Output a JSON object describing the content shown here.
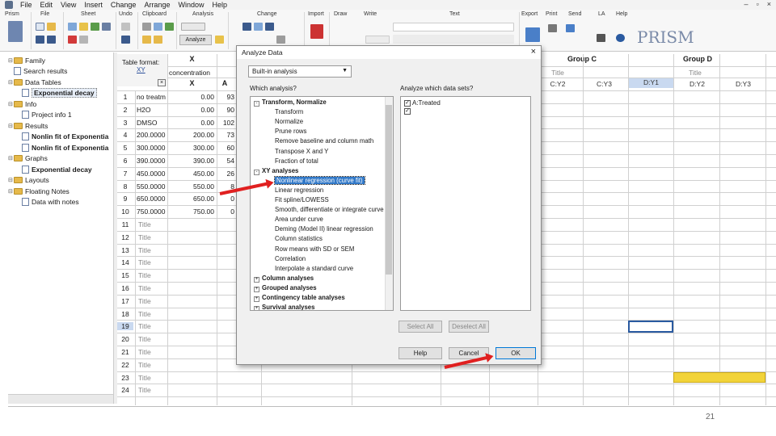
{
  "menu": [
    "Prism",
    "File",
    "Edit",
    "View",
    "Insert",
    "Change",
    "Arrange",
    "Window",
    "Help"
  ],
  "ribbon_groups": [
    "Prism",
    "File",
    "Sheet",
    "Undo",
    "Clipboard",
    "Analysis",
    "Change",
    "Import",
    "Draw",
    "Write",
    "Text",
    "Export",
    "Print",
    "Send",
    "LA",
    "Help"
  ],
  "ribbon_analyze": "Analyze",
  "brand": "PRISM",
  "navigator": [
    {
      "label": "Family",
      "type": "folder",
      "indent": 0
    },
    {
      "label": "Search results",
      "type": "sheet",
      "indent": 0
    },
    {
      "label": "Data Tables",
      "type": "folder",
      "indent": 0
    },
    {
      "label": "Exponential decay",
      "type": "sheet",
      "indent": 1,
      "selected": true
    },
    {
      "label": "Info",
      "type": "folder",
      "indent": 0
    },
    {
      "label": "Project info 1",
      "type": "sheet",
      "indent": 1
    },
    {
      "label": "Results",
      "type": "folder",
      "indent": 0
    },
    {
      "label": "Nonlin fit of Exponentia",
      "type": "sheet",
      "indent": 1,
      "bold": true
    },
    {
      "label": "Nonlin fit of Exponentia",
      "type": "sheet",
      "indent": 1,
      "bold": true
    },
    {
      "label": "Graphs",
      "type": "folder",
      "indent": 0
    },
    {
      "label": "Exponential decay",
      "type": "sheet",
      "indent": 1,
      "bold": true
    },
    {
      "label": "Layouts",
      "type": "folder",
      "indent": 0
    },
    {
      "label": "Floating Notes",
      "type": "folder",
      "indent": 0
    },
    {
      "label": "Data with notes",
      "type": "sheet",
      "indent": 1
    }
  ],
  "table": {
    "format_label": "Table format:",
    "format_value": "XY",
    "col_x": "X",
    "x_title": "concentration",
    "x_sub": "X",
    "col_a": "A",
    "row_titles": [
      "no treatm",
      "H2O",
      "DMSO",
      "200.0000",
      "300.0000",
      "390.0000",
      "450.0000",
      "550.0000",
      "650.0000",
      "750.0000"
    ],
    "x_values": [
      "0.00",
      "0.00",
      "0.00",
      "200.00",
      "300.00",
      "390.00",
      "450.00",
      "550.00",
      "650.00",
      "750.00"
    ],
    "a_values": [
      "93",
      "90",
      "102",
      "73",
      "60",
      "54",
      "26",
      "8",
      "0",
      "0"
    ],
    "title_placeholder": "Title",
    "row_count": 24,
    "group_c": "Group C",
    "group_d": "Group D",
    "group_d_title": "Title",
    "group_c_title": "Title",
    "sub_c": [
      "C:Y2",
      "C:Y3"
    ],
    "sub_d": [
      "D:Y1",
      "D:Y2",
      "D:Y3"
    ]
  },
  "dialog": {
    "title": "Analyze Data",
    "close": "×",
    "select_value": "Built-in analysis",
    "which_label": "Which analysis?",
    "datasets_label": "Analyze which data sets?",
    "tree": [
      {
        "label": "Transform, Normalize",
        "cat": true,
        "sign": "-"
      },
      {
        "label": "Transform"
      },
      {
        "label": "Normalize"
      },
      {
        "label": "Prune rows"
      },
      {
        "label": "Remove baseline and column math"
      },
      {
        "label": "Transpose X and Y"
      },
      {
        "label": "Fraction of total"
      },
      {
        "label": "XY analyses",
        "cat": true,
        "sign": "-"
      },
      {
        "label": "Nonlinear regression (curve fit)",
        "highlight": true
      },
      {
        "label": "Linear regression"
      },
      {
        "label": "Fit spline/LOWESS"
      },
      {
        "label": "Smooth, differentiate or integrate curve"
      },
      {
        "label": "Area under curve"
      },
      {
        "label": "Deming (Model II) linear regression"
      },
      {
        "label": "Column statistics"
      },
      {
        "label": "Row means with SD or SEM"
      },
      {
        "label": "Correlation"
      },
      {
        "label": "Interpolate a standard curve"
      },
      {
        "label": "Column analyses",
        "cat": true,
        "sign": "+"
      },
      {
        "label": "Grouped analyses",
        "cat": true,
        "sign": "+"
      },
      {
        "label": "Contingency table analyses",
        "cat": true,
        "sign": "+"
      },
      {
        "label": "Survival analyses",
        "cat": true,
        "sign": "+"
      }
    ],
    "datasets": [
      "A:Treated",
      ""
    ],
    "select_all": "Select All",
    "deselect_all": "Deselect All",
    "help": "Help",
    "cancel": "Cancel",
    "ok": "OK"
  },
  "page_number": "21",
  "colors": {
    "highlight": "#3078c8",
    "arrow": "#e02020",
    "selected_header": "#c9d9f0",
    "yellow": "#f2d33a"
  }
}
